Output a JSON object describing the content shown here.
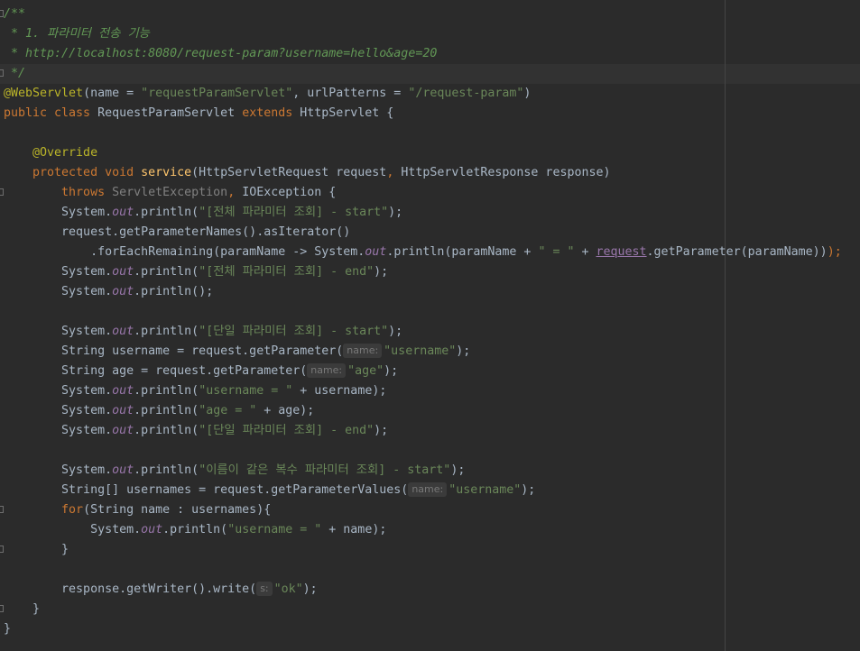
{
  "editor": {
    "code": {
      "l1": "/**",
      "l2": " * 1. 파라미터 전송 기능",
      "l3a": " * ",
      "l3b": "http://localhost:8080/request-param?username=hello&age=20",
      "l4": " */",
      "l5_ann": "@WebServlet",
      "l5_p1": "(name = ",
      "l5_s1": "\"requestParamServlet\"",
      "l5_p2": ", urlPatterns = ",
      "l5_s2": "\"/request-param\"",
      "l5_p3": ")",
      "l6_kw1": "public class ",
      "l6_p1": "RequestParamServlet ",
      "l6_kw2": "extends ",
      "l6_p2": "HttpServlet {",
      "l8_ann": "    @Override",
      "l9_kw": "    protected void ",
      "l9_fn": "service",
      "l9_p1": "(HttpServletRequest request",
      "l9_c1": ", ",
      "l9_p2": "HttpServletResponse response)",
      "l10_kw": "        throws ",
      "l10_g": "ServletException",
      "l10_c": ", ",
      "l10_p": "IOException {",
      "sys": "System.",
      "out": "out",
      "println": ".println(",
      "close": ");",
      "indent8": "        ",
      "l11_s": "\"[전체 파라미터 조회] - start\"",
      "l12": "        request.getParameterNames().asIterator()",
      "l13_p1": "            .forEachRemaining(paramName -> System.",
      "l13_p2": ".println(paramName + ",
      "l13_s": "\" = \"",
      "l13_p3": " + ",
      "l13_cap": "request",
      "l13_p4": ".getParameter(paramName))",
      "l13_semi": ");",
      "l14_s": "\"[전체 파라미터 조회] - end\"",
      "l15_tail": ");",
      "l17_s": "\"[단일 파라미터 조회] - start\"",
      "l18_p": "        String username = request.getParameter(",
      "hint_name": "name:",
      "l18_s": "\"username\"",
      "l19_p": "        String age = request.getParameter(",
      "l19_s": "\"age\"",
      "l20_s": "\"username = \"",
      "l20_p": " + username",
      "l21_s": "\"age = \"",
      "l21_p": " + age",
      "l22_s": "\"[단일 파라미터 조회] - end\"",
      "l24_s": "\"이름이 같은 복수 파라미터 조회] - start\"",
      "l25_p": "        String[] usernames = request.getParameterValues(",
      "l25_s": "\"username\"",
      "l26_kw": "        for",
      "l26_p": "(String name : usernames){",
      "l27_pre": "            System.",
      "l27_s": "\"username = \"",
      "l27_p": " + name",
      "l28": "        }",
      "l30_p": "        response.getWriter().write(",
      "hint_s": "s:",
      "l30_s": "\"ok\"",
      "l31": "    }",
      "l32": "}"
    }
  }
}
